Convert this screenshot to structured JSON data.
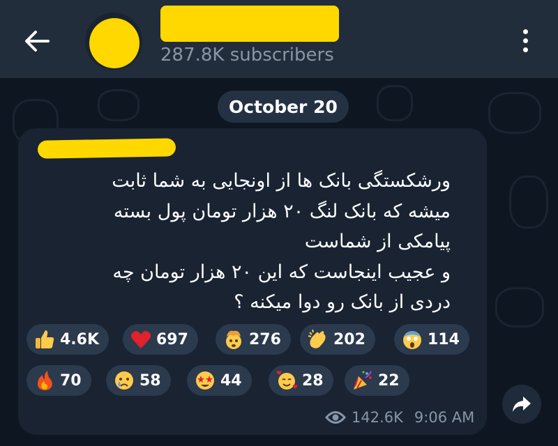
{
  "header": {
    "subscribers": "287.8K subscribers",
    "icons": {
      "back": "arrow-left-icon",
      "menu": "more-vertical-icon"
    }
  },
  "date_separator": "October 20",
  "message": {
    "text": "ورشکستگی بانک ها از اونجایی به شما ثابت\nمیشه که بانک لنگ ۲۰ هزار تومان پول بسته\nپیامکی از شماست\nو عجیب اینجاست که این ۲۰ هزار تومان چه\nدردی از بانک رو دوا میکنه ؟",
    "views": "142.6K",
    "time": "9:06 AM"
  },
  "reactions": [
    {
      "emoji": "thumbs-up",
      "count": "4.6K"
    },
    {
      "emoji": "red-heart",
      "count": "697"
    },
    {
      "emoji": "exploding-head",
      "count": "276"
    },
    {
      "emoji": "clapping-hands",
      "count": "202"
    },
    {
      "emoji": "screaming-face",
      "count": "114"
    },
    {
      "emoji": "fire",
      "count": "70"
    },
    {
      "emoji": "crying-face",
      "count": "58"
    },
    {
      "emoji": "star-struck",
      "count": "44"
    },
    {
      "emoji": "smiling-face-with-hearts",
      "count": "28"
    },
    {
      "emoji": "party-popper",
      "count": "22"
    }
  ],
  "colors": {
    "header_bg": "#212d3b",
    "chat_bg": "#0e1621",
    "bubble_bg": "#192332",
    "reaction_bg": "#2b3a4d",
    "redaction": "#ffd800",
    "muted_text": "#8796a8"
  }
}
